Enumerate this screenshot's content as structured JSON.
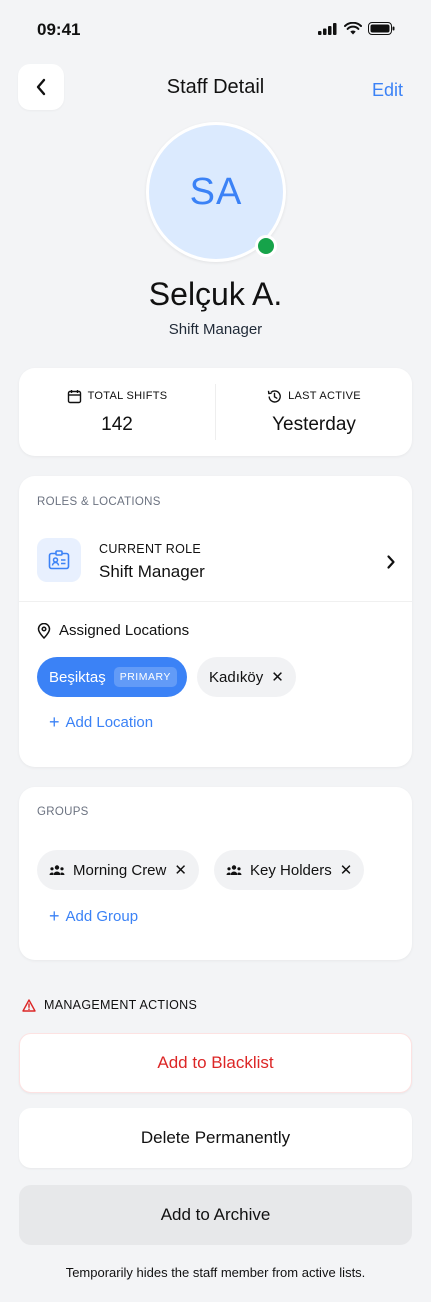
{
  "status_bar": {
    "time": "09:41"
  },
  "nav": {
    "title": "Staff Detail",
    "edit_label": "Edit"
  },
  "profile": {
    "initials": "SA",
    "name": "Selçuk A.",
    "role": "Shift Manager",
    "online": true
  },
  "stats": {
    "total_shifts_label": "TOTAL SHIFTS",
    "total_shifts_value": "142",
    "last_active_label": "LAST ACTIVE",
    "last_active_value": "Yesterday"
  },
  "roles": {
    "section_label": "ROLES & LOCATIONS",
    "current_role_label": "CURRENT ROLE",
    "current_role_value": "Shift Manager",
    "locations_label": "Assigned Locations",
    "locations": [
      {
        "name": "Beşiktaş",
        "badge": "PRIMARY"
      },
      {
        "name": "Kadıköy"
      }
    ],
    "add_location_label": "Add Location"
  },
  "groups": {
    "section_label": "GROUPS",
    "items": [
      {
        "name": "Morning Crew"
      },
      {
        "name": "Key Holders"
      }
    ],
    "add_group_label": "Add Group"
  },
  "management": {
    "section_label": "MANAGEMENT ACTIONS",
    "blacklist_label": "Add to Blacklist",
    "delete_label": "Delete Permanently",
    "archive_label": "Add to Archive",
    "archive_note": "Temporarily hides the staff member from active lists."
  },
  "colors": {
    "accent": "#3b82f6",
    "danger": "#dc2626",
    "online": "#16a34a"
  }
}
